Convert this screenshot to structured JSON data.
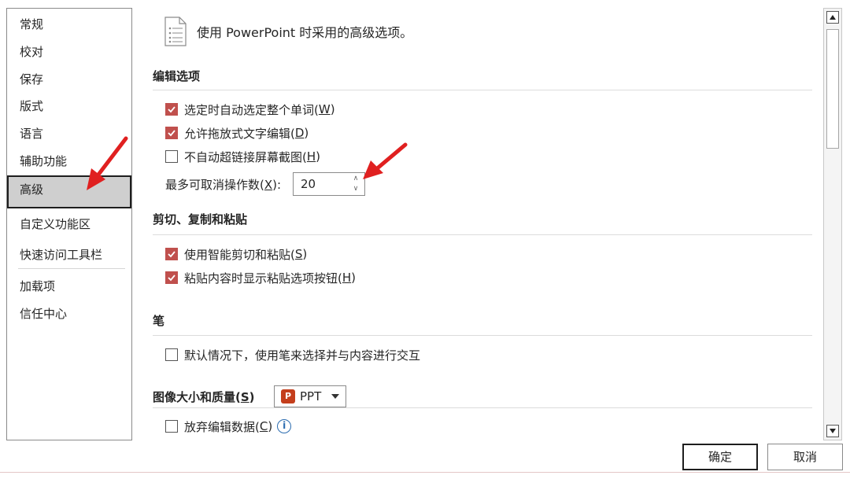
{
  "sidebar": {
    "items": [
      {
        "label": "常规"
      },
      {
        "label": "校对"
      },
      {
        "label": "保存"
      },
      {
        "label": "版式"
      },
      {
        "label": "语言"
      },
      {
        "label": "辅助功能"
      },
      {
        "label": "高级",
        "selected": true
      },
      {
        "label": "自定义功能区"
      },
      {
        "label": "快速访问工具栏"
      },
      {
        "label": "加载项"
      },
      {
        "label": "信任中心"
      }
    ]
  },
  "header": {
    "icon": "document-list-icon",
    "text": "使用 PowerPoint 时采用的高级选项。"
  },
  "sections": {
    "editing": {
      "title": "编辑选项",
      "options": [
        {
          "label": "选定时自动选定整个单词(",
          "key": "W",
          "suffix": ")",
          "checked": true
        },
        {
          "label": "允许拖放式文字编辑(",
          "key": "D",
          "suffix": ")",
          "checked": true
        },
        {
          "label": "不自动超链接屏幕截图(",
          "key": "H",
          "suffix": ")",
          "checked": false
        }
      ],
      "undo": {
        "label_pre": "最多可取消操作数(",
        "key": "X",
        "label_post": "):",
        "value": "20"
      }
    },
    "clipboard": {
      "title": "剪切、复制和粘贴",
      "options": [
        {
          "label": "使用智能剪切和粘贴(",
          "key": "S",
          "suffix": ")",
          "checked": true
        },
        {
          "label": "粘贴内容时显示粘贴选项按钮(",
          "key": "H",
          "suffix": ")",
          "checked": true
        }
      ]
    },
    "pen": {
      "title": "笔",
      "options": [
        {
          "label": "默认情况下，使用笔来选择并与内容进行交互",
          "checked": false
        }
      ]
    },
    "image": {
      "title_pre": "图像大小和质量(",
      "title_key": "S",
      "title_post": ")",
      "dropdown_value": "PPT",
      "options": [
        {
          "label": "放弃编辑数据(",
          "key": "C",
          "suffix": ")",
          "checked": false
        }
      ]
    }
  },
  "buttons": {
    "ok": "确定",
    "cancel": "取消"
  },
  "colors": {
    "checkbox_checked": "#c0504d",
    "arrow": "#e02020",
    "ppt_brand": "#c43e1c",
    "info_blue": "#2b6cb0"
  }
}
